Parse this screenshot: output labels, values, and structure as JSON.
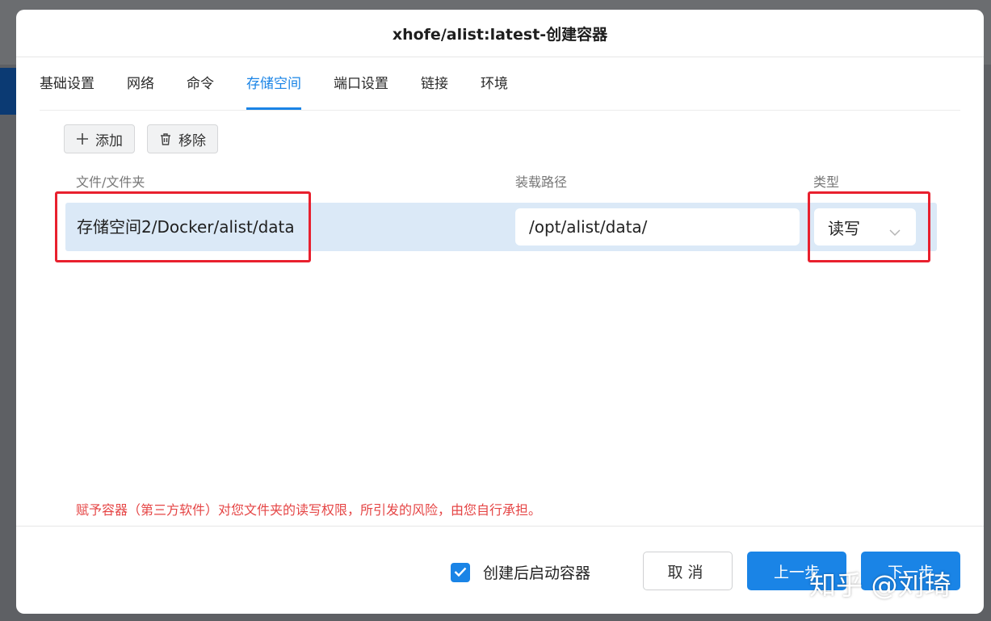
{
  "dialog": {
    "title": "xhofe/alist:latest-创建容器"
  },
  "tabs": [
    {
      "label": "基础设置"
    },
    {
      "label": "网络"
    },
    {
      "label": "命令"
    },
    {
      "label": "存储空间",
      "active": true
    },
    {
      "label": "端口设置"
    },
    {
      "label": "链接"
    },
    {
      "label": "环境"
    }
  ],
  "toolbar": {
    "add_label": "添加",
    "remove_label": "移除"
  },
  "table": {
    "headers": {
      "file": "文件/文件夹",
      "mount": "装载路径",
      "type": "类型"
    },
    "rows": [
      {
        "file": "存储空间2/Docker/alist/data",
        "mount_path": "/opt/alist/data/",
        "type": "读写"
      }
    ]
  },
  "warning": "赋予容器（第三方软件）对您文件夹的读写权限，所引发的风险，由您自行承担。",
  "footer": {
    "start_after_create_label": "创建后启动容器",
    "start_after_create_checked": true,
    "cancel_label": "取消",
    "prev_label": "上一步",
    "next_label": "下一步"
  },
  "watermark": "知乎 @刘琦",
  "colors": {
    "accent": "#1a84e6",
    "highlight": "#e8202e",
    "warning": "#e54545",
    "row_selected": "#dbe9f7"
  },
  "icons": {
    "add": "plus-icon",
    "remove": "trash-icon",
    "dropdown": "chevron-down-icon",
    "checkbox": "check-icon"
  }
}
